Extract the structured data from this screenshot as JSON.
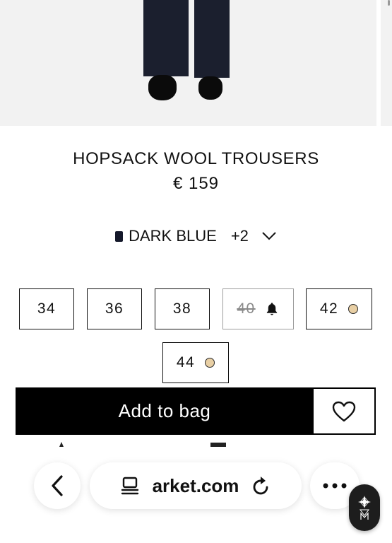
{
  "product": {
    "title": "HOPSACK WOOL TROUSERS",
    "price": "€ 159"
  },
  "color": {
    "name": "DARK BLUE",
    "more": "+2",
    "swatch_color": "#14182a"
  },
  "sizes": [
    {
      "label": "34",
      "available": true,
      "low_stock": false,
      "notify": false
    },
    {
      "label": "36",
      "available": true,
      "low_stock": false,
      "notify": false
    },
    {
      "label": "38",
      "available": true,
      "low_stock": false,
      "notify": false
    },
    {
      "label": "40",
      "available": false,
      "low_stock": false,
      "notify": true
    },
    {
      "label": "42",
      "available": true,
      "low_stock": true,
      "notify": false
    },
    {
      "label": "44",
      "available": true,
      "low_stock": true,
      "notify": false
    }
  ],
  "actions": {
    "add_to_bag": "Add to bag"
  },
  "browser": {
    "url": "arket.com",
    "icons": [
      "chevron-left-icon",
      "reader-icon",
      "reload-icon",
      "more-icon",
      "assistant-icon"
    ]
  },
  "colors": {
    "button_bg": "#000000",
    "low_stock_dot": "#e8cfa4",
    "image_bg": "#f2f2f2"
  }
}
